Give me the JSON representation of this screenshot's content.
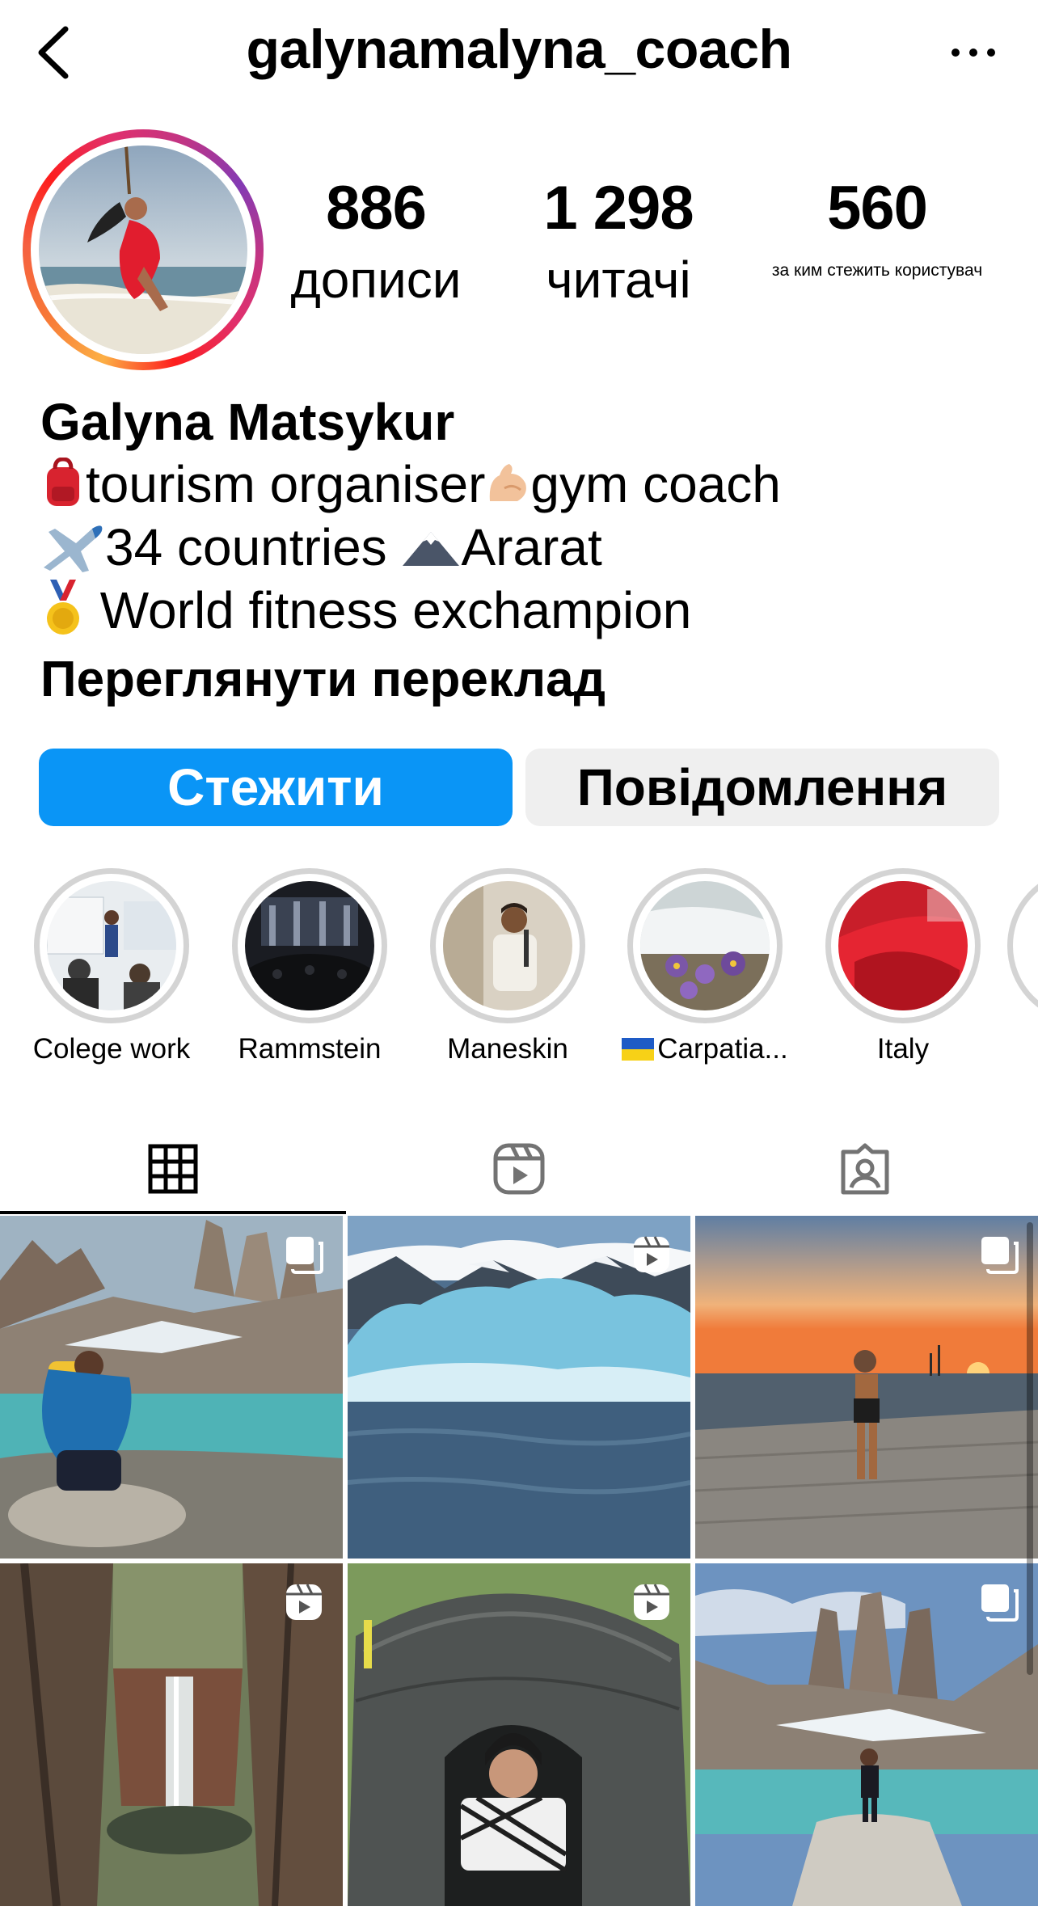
{
  "header": {
    "username": "galynamalyna_coach",
    "back_icon": "chevron-left-icon",
    "more_icon": "ellipsis-icon"
  },
  "stats": [
    {
      "value": "886",
      "label": "дописи"
    },
    {
      "value": "1 298",
      "label": "читачі"
    },
    {
      "value": "560",
      "label": "за ким стежить користувач"
    }
  ],
  "bio": {
    "name": "Galyna Matsykur",
    "line1_a": "tourism organiser",
    "line1_b": "gym coach",
    "line2_a": "34 countries ",
    "line2_b": "Ararat",
    "line3": " World fitness exchampion",
    "translate": "Переглянути переклад"
  },
  "buttons": {
    "follow": "Стежити",
    "message": "Повідомлення"
  },
  "highlights": [
    {
      "label": "Colege work"
    },
    {
      "label": "Rammstein"
    },
    {
      "label": "Maneskin"
    },
    {
      "label": "Carpatia..."
    },
    {
      "label": "Italy"
    }
  ],
  "tabs": [
    {
      "name": "grid-icon",
      "active": true
    },
    {
      "name": "reels-icon",
      "active": false
    },
    {
      "name": "tagged-icon",
      "active": false
    }
  ],
  "posts": [
    {
      "kind": "carousel"
    },
    {
      "kind": "reel"
    },
    {
      "kind": "carousel"
    },
    {
      "kind": "reel"
    },
    {
      "kind": "reel"
    },
    {
      "kind": "carousel"
    }
  ],
  "colors": {
    "follow_button": "#0a95f6",
    "message_button": "#efefef",
    "highlight_ring": "#d4d4d4"
  }
}
